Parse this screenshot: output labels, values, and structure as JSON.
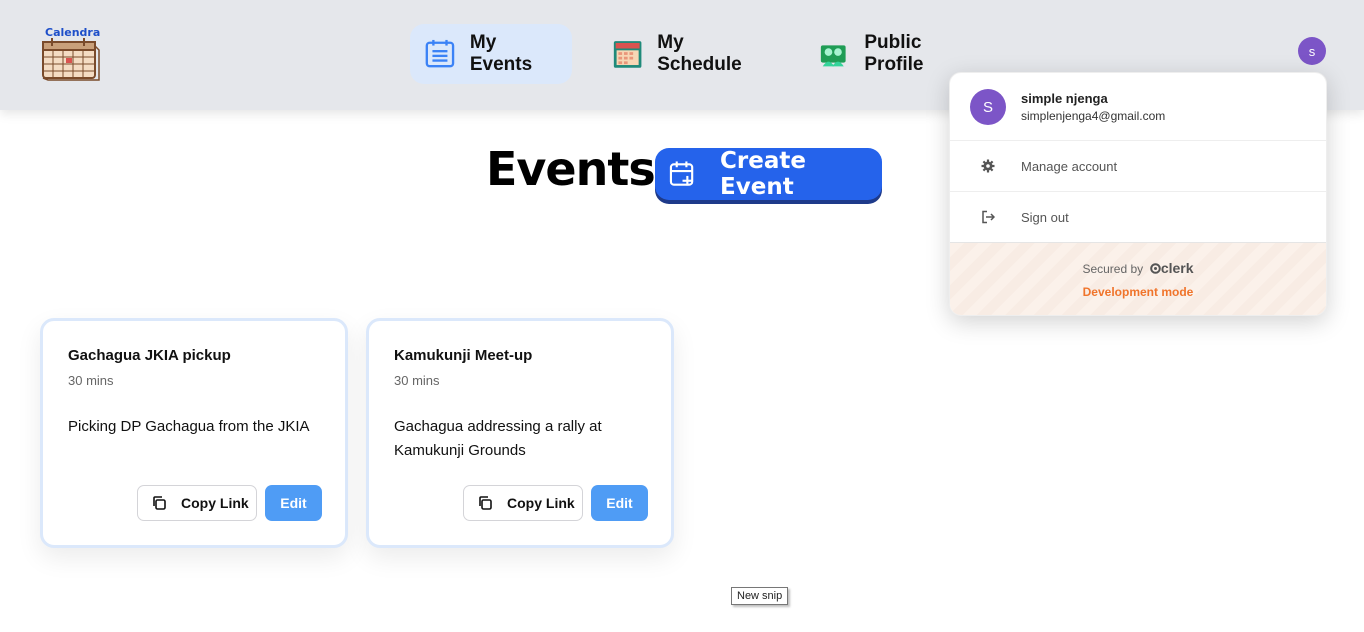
{
  "header": {
    "logo_text": "Calendra",
    "nav": [
      {
        "label": "My Events",
        "icon": "calendar-list-icon",
        "active": true
      },
      {
        "label": "My Schedule",
        "icon": "schedule-icon",
        "active": false
      },
      {
        "label": "Public Profile",
        "icon": "profile-group-icon",
        "active": false
      }
    ],
    "avatar_initial": "s"
  },
  "main": {
    "title": "Events",
    "create_label": "Create Event"
  },
  "events": [
    {
      "name": "Gachagua JKIA pickup",
      "duration": "30 mins",
      "description": "Picking DP Gachagua from the JKIA",
      "copy_label": "Copy Link",
      "edit_label": "Edit"
    },
    {
      "name": "Kamukunji Meet-up",
      "duration": "30 mins",
      "description": "Gachagua addressing a rally at Kamukunji Grounds",
      "copy_label": "Copy Link",
      "edit_label": "Edit"
    }
  ],
  "user_menu": {
    "avatar_initial": "S",
    "name": "simple njenga",
    "email": "simplenjenga4@gmail.com",
    "manage_label": "Manage account",
    "signout_label": "Sign out",
    "secured_by": "Secured by",
    "brand": "clerk",
    "dev_mode": "Development mode"
  },
  "tooltip": {
    "label": "New snip"
  },
  "colors": {
    "primary": "#2563eb",
    "edit": "#4f9cf5",
    "avatar": "#7c55c7",
    "active_nav": "#dbe8fb",
    "dev_mode": "#f0742b"
  }
}
